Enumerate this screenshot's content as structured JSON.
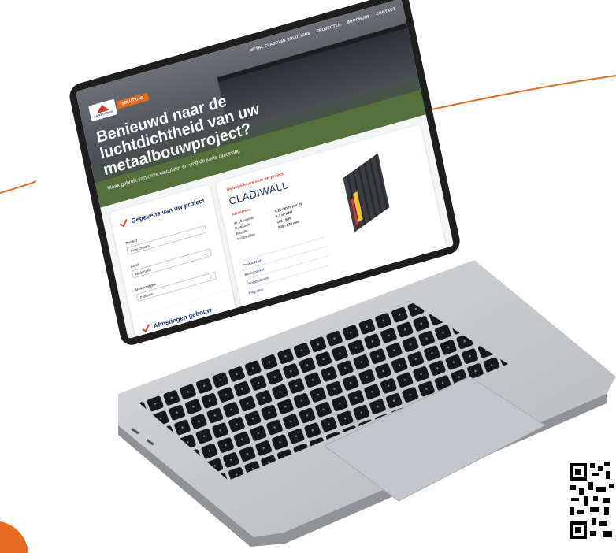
{
  "colors": {
    "accent": "#e66a1f",
    "navy": "#1e3766",
    "red": "#e0402e",
    "laptop_body": "#c9cbcf",
    "keys": "#1a1b1d"
  },
  "site": {
    "nav": [
      "METAL CLADDING SOLUTIONS",
      "PROJECTEN",
      "BROCHURE",
      "CONTACT"
    ],
    "logo_text": "SAINT-GOBAIN",
    "badge": "SOLUTIONS",
    "hero_title": "Benieuwd naar de luchtdichtheid van uw metaalbouwproject?",
    "hero_subtitle": "Maak gebruik van onze calculator en vind de juiste oplossing",
    "form": {
      "title": "Gegevens van uw project",
      "fields": [
        {
          "label": "Project",
          "value": "Projectnaam"
        },
        {
          "label": "Land",
          "value": "Nederland"
        },
        {
          "label": "Gebouwtype",
          "value": "Industrie"
        }
      ],
      "next_title": "Afmetingen gebouw"
    },
    "result": {
      "kicker": "De beste keuze voor uw project",
      "product": "CLADIWALL",
      "spec_heading": "Kenmerken",
      "specs": [
        {
          "key": "qv;10 waarde",
          "value": "0,15 dm³/s per m²"
        },
        {
          "key": "Rₐ waarde",
          "value": "5,7 m²K/W"
        },
        {
          "key": "Breedte",
          "value": "166 / 600"
        },
        {
          "key": "Isolatiedikte",
          "value": "200 / 230 mm"
        }
      ],
      "links": [
        "Productblad",
        "Bestekstekst",
        "Principedetails",
        "Projecten"
      ]
    }
  }
}
